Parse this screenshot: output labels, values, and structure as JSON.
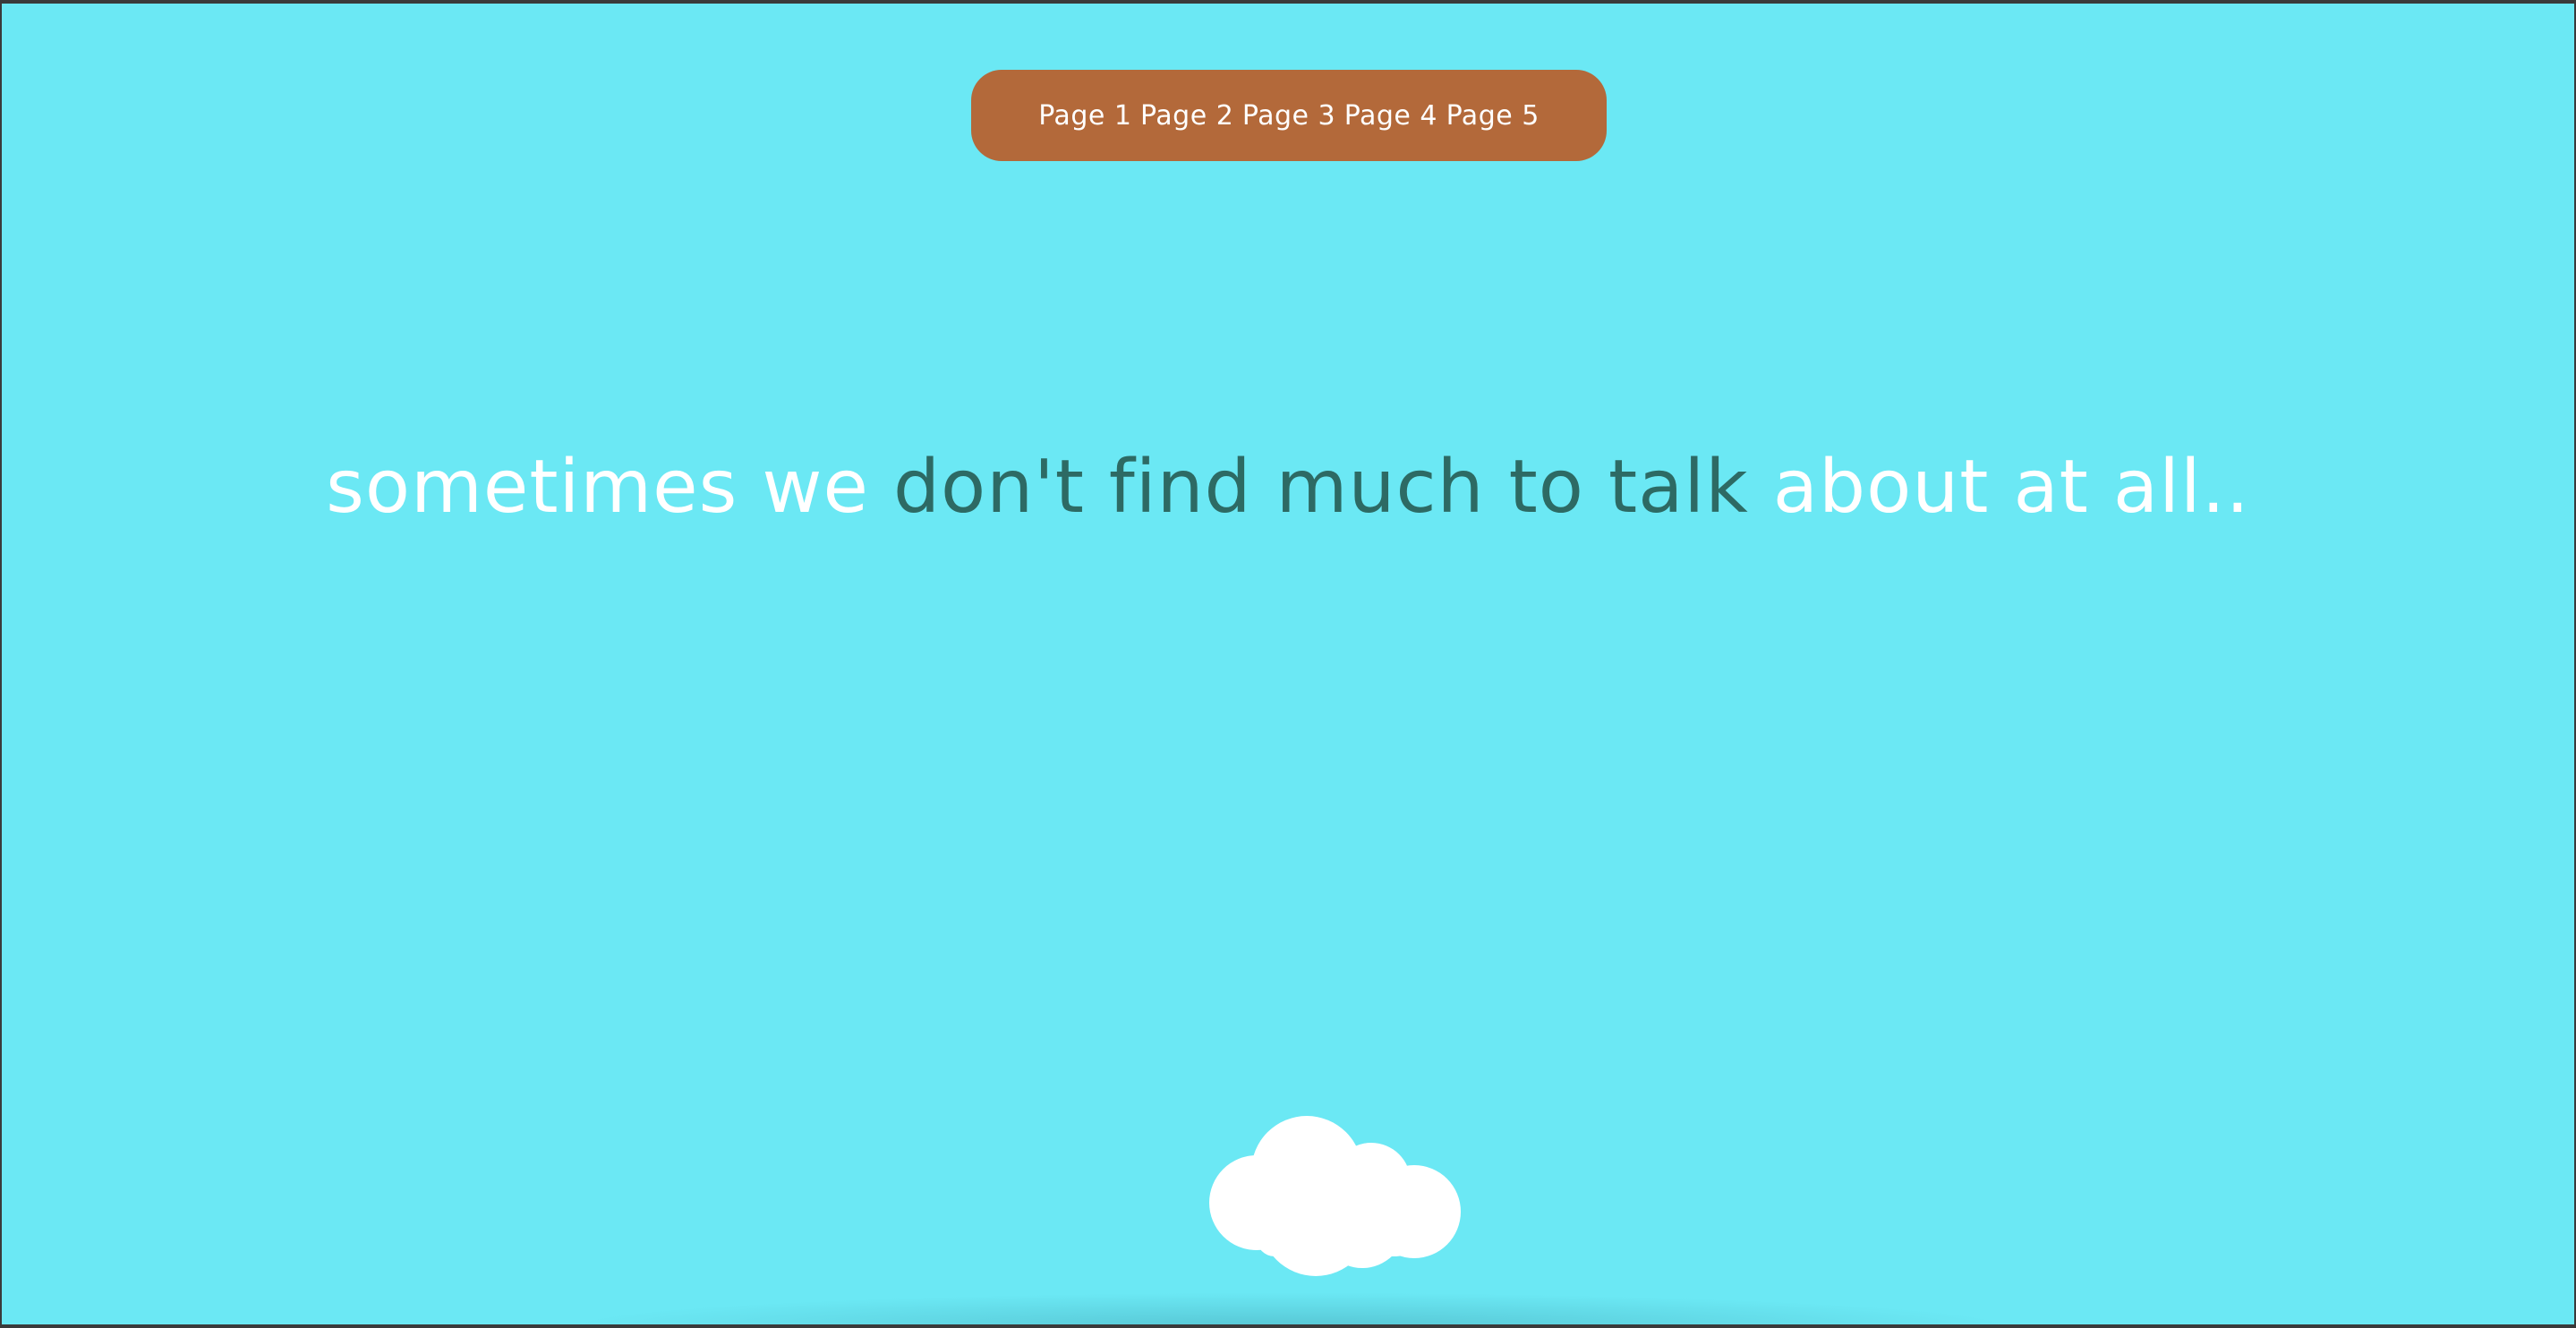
{
  "nav": {
    "items": [
      {
        "label": "Page 1"
      },
      {
        "label": "Page 2"
      },
      {
        "label": "Page 3"
      },
      {
        "label": "Page 4"
      },
      {
        "label": "Page 5"
      }
    ]
  },
  "headline": {
    "part1": "sometimes we",
    "part2": "don't find much to talk",
    "part3": "about at all.."
  },
  "colors": {
    "background": "#6be8f4",
    "nav_pill": "#b3693a",
    "text_light": "#ffffff",
    "text_dark": "#2d6a64",
    "cloud": "#ffffff"
  },
  "icons": {
    "cloud": "cloud-icon"
  }
}
